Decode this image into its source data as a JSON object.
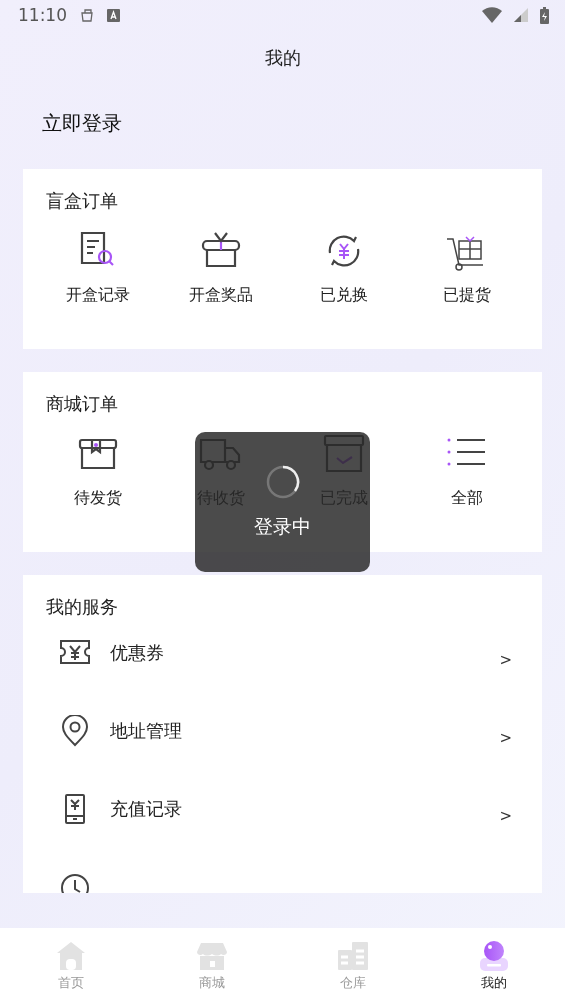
{
  "status_bar": {
    "time": "11:10"
  },
  "header": {
    "title": "我的"
  },
  "login": {
    "label": "立即登录"
  },
  "blind_box_orders": {
    "title": "盲盒订单",
    "items": [
      {
        "kind": "record",
        "label": "开盒记录"
      },
      {
        "kind": "gift",
        "label": "开盒奖品"
      },
      {
        "kind": "exchange",
        "label": "已兑换"
      },
      {
        "kind": "cart",
        "label": "已提货"
      }
    ]
  },
  "mall_orders": {
    "title": "商城订单",
    "items": [
      {
        "kind": "package",
        "label": "待发货"
      },
      {
        "kind": "truck",
        "label": "待收货"
      },
      {
        "kind": "done",
        "label": "已完成"
      },
      {
        "kind": "list",
        "label": "全部"
      }
    ]
  },
  "services": {
    "title": "我的服务",
    "items": [
      {
        "kind": "coupon",
        "label": "优惠券",
        "arrow": ">"
      },
      {
        "kind": "location",
        "label": "地址管理",
        "arrow": ">"
      },
      {
        "kind": "recharge",
        "label": "充值记录",
        "arrow": ">"
      },
      {
        "kind": "support"
      }
    ]
  },
  "toast": {
    "label": "登录中"
  },
  "tab_bar": [
    {
      "kind": "home",
      "label": "首页",
      "selected": false
    },
    {
      "kind": "shop",
      "label": "商城",
      "selected": false
    },
    {
      "kind": "warehouse",
      "label": "仓库",
      "selected": false
    },
    {
      "kind": "profile",
      "label": "我的",
      "selected": true
    }
  ]
}
